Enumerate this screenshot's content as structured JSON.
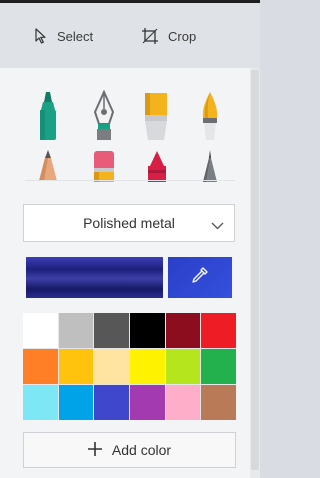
{
  "toolbar": {
    "select_label": "Select",
    "crop_label": "Crop"
  },
  "brushes": [
    {
      "name": "marker",
      "icon": "marker-icon",
      "color": "#1aa083"
    },
    {
      "name": "calligraphy-pen",
      "icon": "fountain-pen-icon",
      "color": "#7b7d80"
    },
    {
      "name": "oil-brush",
      "icon": "flat-brush-icon",
      "color": "#f4b21d"
    },
    {
      "name": "watercolor",
      "icon": "round-brush-icon",
      "color": "#f4b21d"
    },
    {
      "name": "pencil",
      "icon": "pencil-icon",
      "color": "#e8a87c"
    },
    {
      "name": "eraser",
      "icon": "eraser-icon",
      "color": "#e85c7a"
    },
    {
      "name": "crayon",
      "icon": "crayon-icon",
      "color": "#d61f45"
    },
    {
      "name": "pixel-pen",
      "icon": "pixel-pen-icon",
      "color": "#7a7f86"
    }
  ],
  "texture": {
    "selected": "Polished metal"
  },
  "current_color": {
    "value": "#2a2d95"
  },
  "palette": [
    "#ffffff",
    "#bfbfbf",
    "#575757",
    "#000000",
    "#8c0d1d",
    "#ee1c24",
    "#ff7f27",
    "#ffc30e",
    "#ffe3a0",
    "#fef200",
    "#b5e61d",
    "#22b14c",
    "#7de7f6",
    "#00a2e8",
    "#3f48cc",
    "#a33aaf",
    "#ffaec9",
    "#b97a57"
  ],
  "add_color": {
    "label": "Add color"
  }
}
